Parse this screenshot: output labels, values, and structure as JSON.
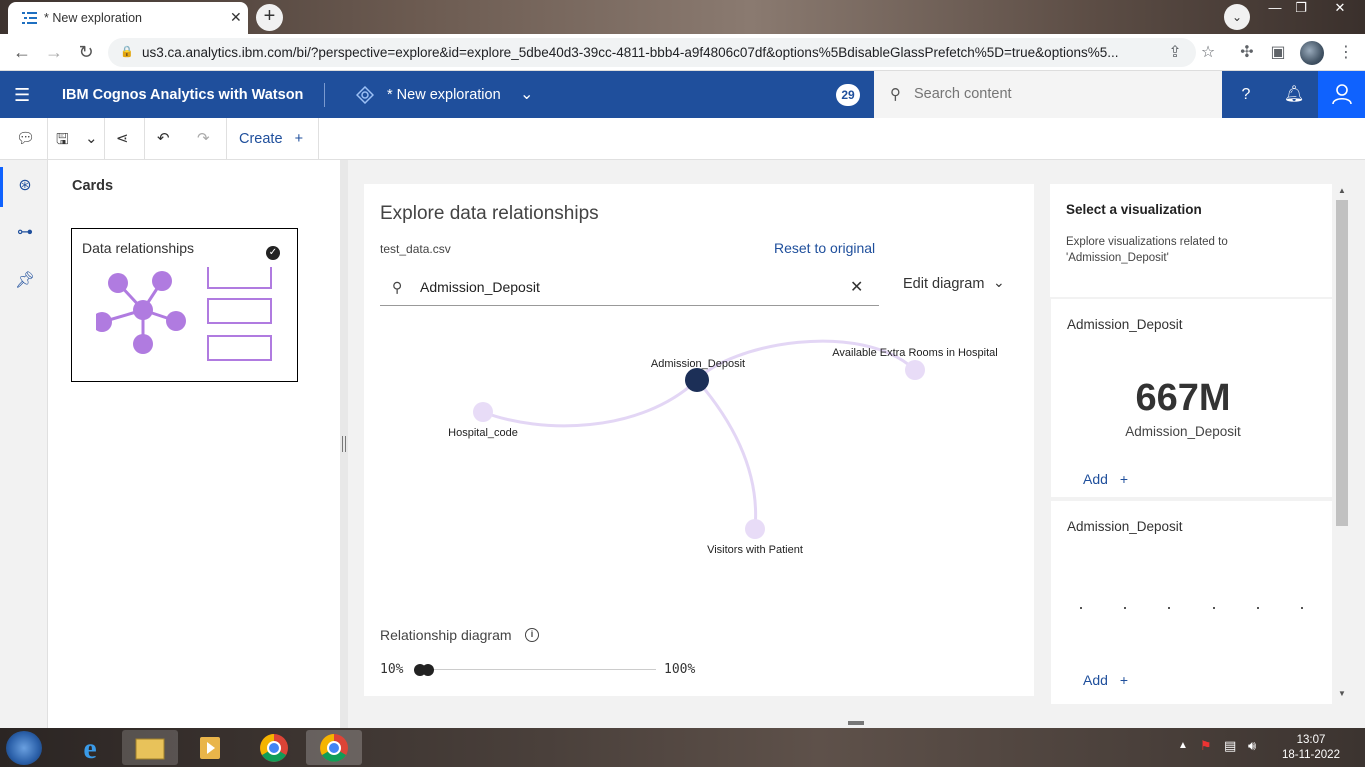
{
  "browser": {
    "tab_title": "* New exploration",
    "new_tab_label": "+",
    "url": "us3.ca.analytics.ibm.com/bi/?perspective=explore&id=explore_5dbe40d3-39cc-4811-bbb4-a9f4806c07df&options%5BdisableGlassPrefetch%5D=true&options%5..."
  },
  "header": {
    "brand": "IBM Cognos Analytics with Watson",
    "exploration_title": "* New exploration",
    "notification_count": "29",
    "search_placeholder": "Search content"
  },
  "toolbar": {
    "create_label": "Create"
  },
  "cards_panel": {
    "title": "Cards",
    "card_label": "Data relationships"
  },
  "explore": {
    "heading": "Explore data relationships",
    "file_name": "test_data.csv",
    "reset_label": "Reset to original",
    "search_value": "Admission_Deposit",
    "edit_diagram_label": "Edit diagram",
    "nodes": {
      "center": "Admission_Deposit",
      "n1": "Available Extra Rooms in Hospital",
      "n2": "Hospital_code",
      "n3": "Visitors with Patient"
    },
    "relationship_label": "Relationship diagram",
    "slider_min": "10%",
    "slider_max": "100%"
  },
  "right_panel": {
    "title": "Select a visualization",
    "description": "Explore visualizations related to 'Admission_Deposit'",
    "viz1": {
      "title": "Admission_Deposit",
      "value": "667M",
      "value_label": "Admission_Deposit",
      "add_label": "Add"
    },
    "viz2": {
      "title": "Admission_Deposit",
      "add_label": "Add"
    }
  },
  "taskbar": {
    "time": "13:07",
    "date": "18-11-2022"
  },
  "colors": {
    "ibm_header": "#1f4f9c",
    "node_center": "#1c2f57",
    "node_other": "#e8dcf7",
    "edge": "#e3d6f5",
    "card_purple": "#b07be0"
  }
}
